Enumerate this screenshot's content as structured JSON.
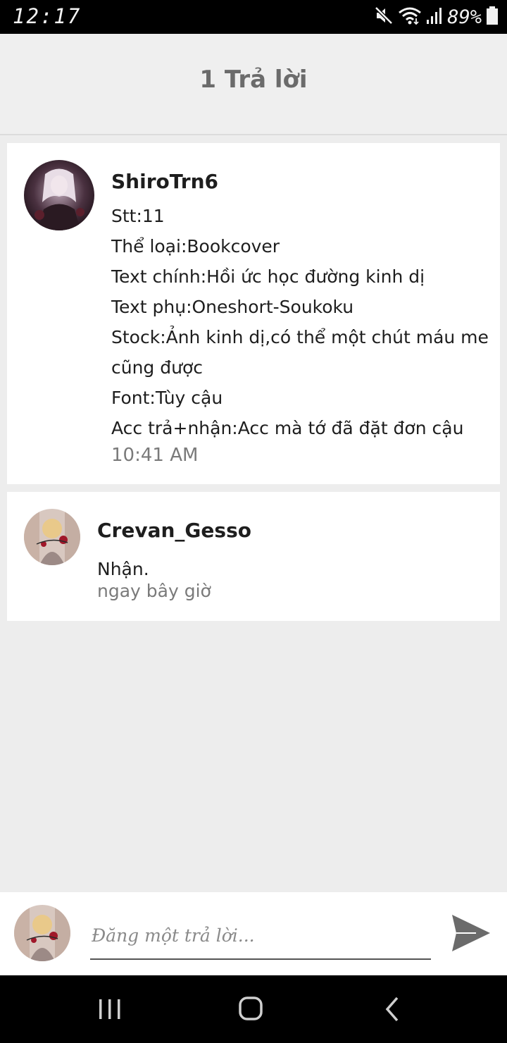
{
  "status_bar": {
    "time": "12:17",
    "battery_percent": "89%",
    "icons": [
      "mute-icon",
      "wifi-icon",
      "signal-icon",
      "battery-icon"
    ]
  },
  "header": {
    "title": "1 Trả lời"
  },
  "comments": [
    {
      "username": "ShiroTrn6",
      "lines": [
        "Stt:11",
        "Thể loại:Bookcover",
        "Text chính:Hồi ức học đường kinh dị",
        "Text phụ:Oneshort-Soukoku",
        "Stock:Ảnh kinh dị,có thể một chút máu me",
        "cũng được",
        "Font:Tùy cậu",
        "Acc trả+nhận:Acc mà tớ đã đặt đơn cậu"
      ],
      "time": "10:41 AM"
    },
    {
      "username": "Crevan_Gesso",
      "lines": [
        "Nhận."
      ],
      "time": "ngay bây giờ"
    }
  ],
  "composer": {
    "placeholder": "Đăng một trả lời...",
    "value": ""
  },
  "nav_bar": {
    "icons": [
      "recent-apps-icon",
      "home-icon",
      "back-icon"
    ]
  },
  "colors": {
    "background": "#ededed",
    "card": "#ffffff",
    "header_title": "#6b6b6b",
    "timestamp": "#7a7a7a",
    "send_icon": "#6b6b6b"
  }
}
